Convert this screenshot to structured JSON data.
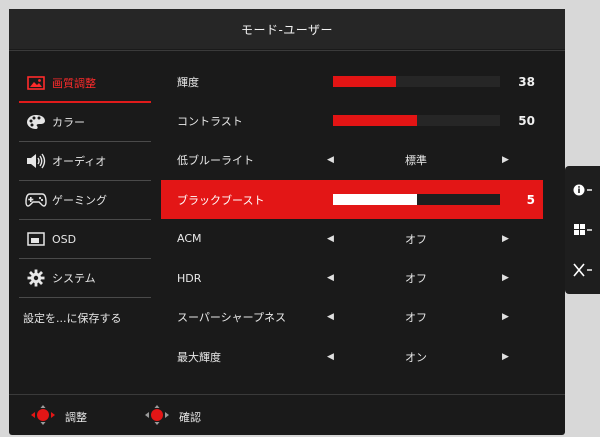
{
  "title": "モード-ユーザー",
  "sidebar": {
    "items": [
      {
        "label": "画質調整",
        "icon": "picture-icon",
        "active": true
      },
      {
        "label": "カラー",
        "icon": "palette-icon",
        "active": false
      },
      {
        "label": "オーディオ",
        "icon": "speaker-icon",
        "active": false
      },
      {
        "label": "ゲーミング",
        "icon": "gamepad-icon",
        "active": false
      },
      {
        "label": "OSD",
        "icon": "osd-window-icon",
        "active": false
      },
      {
        "label": "システム",
        "icon": "gear-icon",
        "active": false
      },
      {
        "label": "設定を...に保存する",
        "icon": "",
        "active": false
      }
    ]
  },
  "settings": [
    {
      "label": "輝度",
      "type": "slider",
      "value": "38",
      "fraction": 0.38
    },
    {
      "label": "コントラスト",
      "type": "slider",
      "value": "50",
      "fraction": 0.5
    },
    {
      "label": "低ブルーライト",
      "type": "option",
      "value": "標準"
    },
    {
      "label": "ブラックブースト",
      "type": "slider",
      "value": "5",
      "fraction": 0.5,
      "active": true
    },
    {
      "label": "ACM",
      "type": "option",
      "value": "オフ"
    },
    {
      "label": "HDR",
      "type": "option",
      "value": "オフ"
    },
    {
      "label": "スーパーシャープネス",
      "type": "option",
      "value": "オフ"
    },
    {
      "label": "最大輝度",
      "type": "option",
      "value": "オン"
    }
  ],
  "footer": {
    "adjust_label": "調整",
    "confirm_label": "確認"
  },
  "side_tabs": [
    "info-icon",
    "input-icon",
    "close-icon"
  ],
  "colors": {
    "accent": "#e31616",
    "background": "#1a1a1a"
  }
}
